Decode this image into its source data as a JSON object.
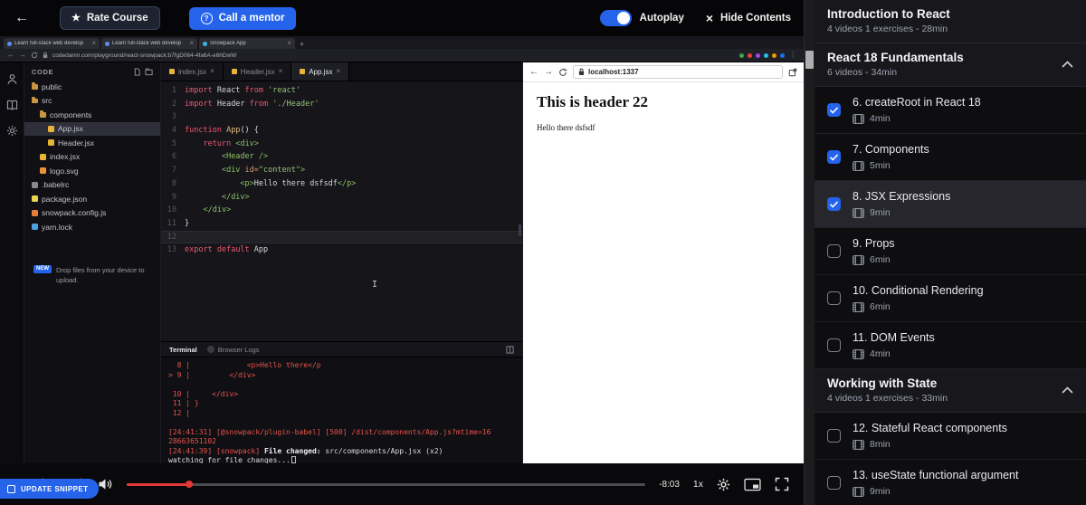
{
  "topbar": {
    "rate_course": "Rate Course",
    "call_mentor": "Call a mentor",
    "autoplay": "Autoplay",
    "hide_contents": "Hide Contents"
  },
  "chrome": {
    "tabs": [
      {
        "label": "Learn full-stack web develop",
        "color": "#5b8def"
      },
      {
        "label": "Learn full-stack web develop",
        "color": "#5b8def"
      },
      {
        "label": "Snowpack App",
        "color": "#37b5e4"
      }
    ],
    "url": "codedamn.com/playground/react-snowpack:b7fgD064-4fa6A-e6hDwW",
    "ext_colors": [
      "#34a853",
      "#ea4335",
      "#a142f4",
      "#24c1e0",
      "#f29900",
      "#1a73e8"
    ]
  },
  "ide": {
    "explorer_title": "CODE",
    "files": [
      {
        "name": "public",
        "type": "folder",
        "color": "#c8973f",
        "indent": 0,
        "selected": false
      },
      {
        "name": "src",
        "type": "folder",
        "color": "#c8973f",
        "indent": 0,
        "selected": false
      },
      {
        "name": "components",
        "type": "folder",
        "color": "#c8973f",
        "indent": 1,
        "selected": false
      },
      {
        "name": "App.jsx",
        "type": "file",
        "color": "#e8b339",
        "indent": 2,
        "selected": true
      },
      {
        "name": "Header.jsx",
        "type": "file",
        "color": "#e8b339",
        "indent": 2,
        "selected": false
      },
      {
        "name": "index.jsx",
        "type": "file",
        "color": "#e8b339",
        "indent": 1,
        "selected": false
      },
      {
        "name": "logo.svg",
        "type": "file",
        "color": "#e8913a",
        "indent": 1,
        "selected": false
      },
      {
        "name": ".babelrc",
        "type": "file",
        "color": "#8a8a8a",
        "indent": 0,
        "selected": false
      },
      {
        "name": "package.json",
        "type": "file",
        "color": "#e8d44d",
        "indent": 0,
        "selected": false
      },
      {
        "name": "snowpack.config.js",
        "type": "file",
        "color": "#e87d3a",
        "indent": 0,
        "selected": false
      },
      {
        "name": "yarn.lock",
        "type": "file",
        "color": "#4aa0e0",
        "indent": 0,
        "selected": false
      }
    ],
    "new_badge": "NEW",
    "drop_text": "Drop files from your device to upload.",
    "tabs": [
      {
        "label": "index.jsx",
        "active": false
      },
      {
        "label": "Header.jsx",
        "active": false
      },
      {
        "label": "App.jsx",
        "active": true
      }
    ],
    "cursor_line": 12,
    "code": [
      [
        {
          "t": "import",
          "c": "k"
        },
        {
          "t": " React ",
          "c": "p"
        },
        {
          "t": "from",
          "c": "k"
        },
        {
          "t": " ",
          "c": "p"
        },
        {
          "t": "'react'",
          "c": "s"
        }
      ],
      [
        {
          "t": "import",
          "c": "k"
        },
        {
          "t": " Header ",
          "c": "p"
        },
        {
          "t": "from",
          "c": "k"
        },
        {
          "t": " ",
          "c": "p"
        },
        {
          "t": "'./Header'",
          "c": "s"
        }
      ],
      [],
      [
        {
          "t": "function",
          "c": "k"
        },
        {
          "t": " App",
          "c": "f"
        },
        {
          "t": "() {",
          "c": "p"
        }
      ],
      [
        {
          "t": "    ",
          "c": "p"
        },
        {
          "t": "return",
          "c": "k"
        },
        {
          "t": " ",
          "c": "p"
        },
        {
          "t": "<div>",
          "c": "t"
        }
      ],
      [
        {
          "t": "        ",
          "c": "p"
        },
        {
          "t": "<Header />",
          "c": "t"
        }
      ],
      [
        {
          "t": "        ",
          "c": "p"
        },
        {
          "t": "<div ",
          "c": "t"
        },
        {
          "t": "id=",
          "c": "a"
        },
        {
          "t": "\"content\"",
          "c": "s"
        },
        {
          "t": ">",
          "c": "t"
        }
      ],
      [
        {
          "t": "            ",
          "c": "p"
        },
        {
          "t": "<p>",
          "c": "t"
        },
        {
          "t": "Hello there dsfsdf",
          "c": "p"
        },
        {
          "t": "</p>",
          "c": "t"
        }
      ],
      [
        {
          "t": "        ",
          "c": "p"
        },
        {
          "t": "</div>",
          "c": "t"
        }
      ],
      [
        {
          "t": "    ",
          "c": "p"
        },
        {
          "t": "</div>",
          "c": "t"
        }
      ],
      [
        {
          "t": "}",
          "c": "p"
        }
      ],
      [],
      [
        {
          "t": "export",
          "c": "k"
        },
        {
          "t": " ",
          "c": "p"
        },
        {
          "t": "default",
          "c": "k"
        },
        {
          "t": " App",
          "c": "p"
        }
      ]
    ],
    "terminal": {
      "tab1": "Terminal",
      "tab2": "Browser Logs",
      "lines": [
        [
          {
            "t": "  8 |             <p>Hello there</p",
            "c": "r"
          }
        ],
        [
          {
            "t": "> 9 |         </div>",
            "c": "r"
          }
        ],
        [],
        [
          {
            "t": " 10 |     </div>",
            "c": "r"
          }
        ],
        [
          {
            "t": " 11 | }",
            "c": "r"
          }
        ],
        [
          {
            "t": " 12 |",
            "c": "r"
          }
        ],
        [],
        [
          {
            "t": "[24:41:31] [@snowpack/plugin-babel] [500] /dist/components/App.js?mtime=16",
            "c": "r"
          }
        ],
        [
          {
            "t": "28663651102",
            "c": "r"
          }
        ],
        [
          {
            "t": "[24:41:39] [snowpack] ",
            "c": "r"
          },
          {
            "t": "File changed: ",
            "c": "b"
          },
          {
            "t": "src/components/App.jsx (x2)",
            "c": "w"
          }
        ],
        [
          {
            "t": "watching for file changes...",
            "c": "w"
          },
          {
            "t": "",
            "c": "cur"
          }
        ]
      ]
    }
  },
  "preview": {
    "url": "localhost:1337",
    "heading": "This is header 22",
    "body_text": "Hello there dsfsdf"
  },
  "player": {
    "time_remaining": "-8:03",
    "speed": "1x",
    "progress_pct": 12,
    "update_snippet": "UPDATE SNIPPET"
  },
  "sidebar": {
    "sections": [
      {
        "title": "Introduction to React",
        "meta": "4 videos 1 exercises - 28min",
        "expanded": false,
        "lessons": []
      },
      {
        "title": "React 18 Fundamentals",
        "meta": "6 videos - 34min",
        "expanded": true,
        "lessons": [
          {
            "title": "6. createRoot in React 18",
            "duration": "4min",
            "completed": true,
            "active": false
          },
          {
            "title": "7. Components",
            "duration": "5min",
            "completed": true,
            "active": false
          },
          {
            "title": "8. JSX Expressions",
            "duration": "9min",
            "completed": true,
            "active": true
          },
          {
            "title": "9. Props",
            "duration": "6min",
            "completed": false,
            "active": false
          },
          {
            "title": "10. Conditional Rendering",
            "duration": "6min",
            "completed": false,
            "active": false
          },
          {
            "title": "11. DOM Events",
            "duration": "4min",
            "completed": false,
            "active": false
          }
        ]
      },
      {
        "title": "Working with State",
        "meta": "4 videos 1 exercises - 33min",
        "expanded": true,
        "lessons": [
          {
            "title": "12. Stateful React components",
            "duration": "8min",
            "completed": false,
            "active": false
          },
          {
            "title": "13. useState functional argument",
            "duration": "9min",
            "completed": false,
            "active": false
          }
        ]
      }
    ]
  }
}
